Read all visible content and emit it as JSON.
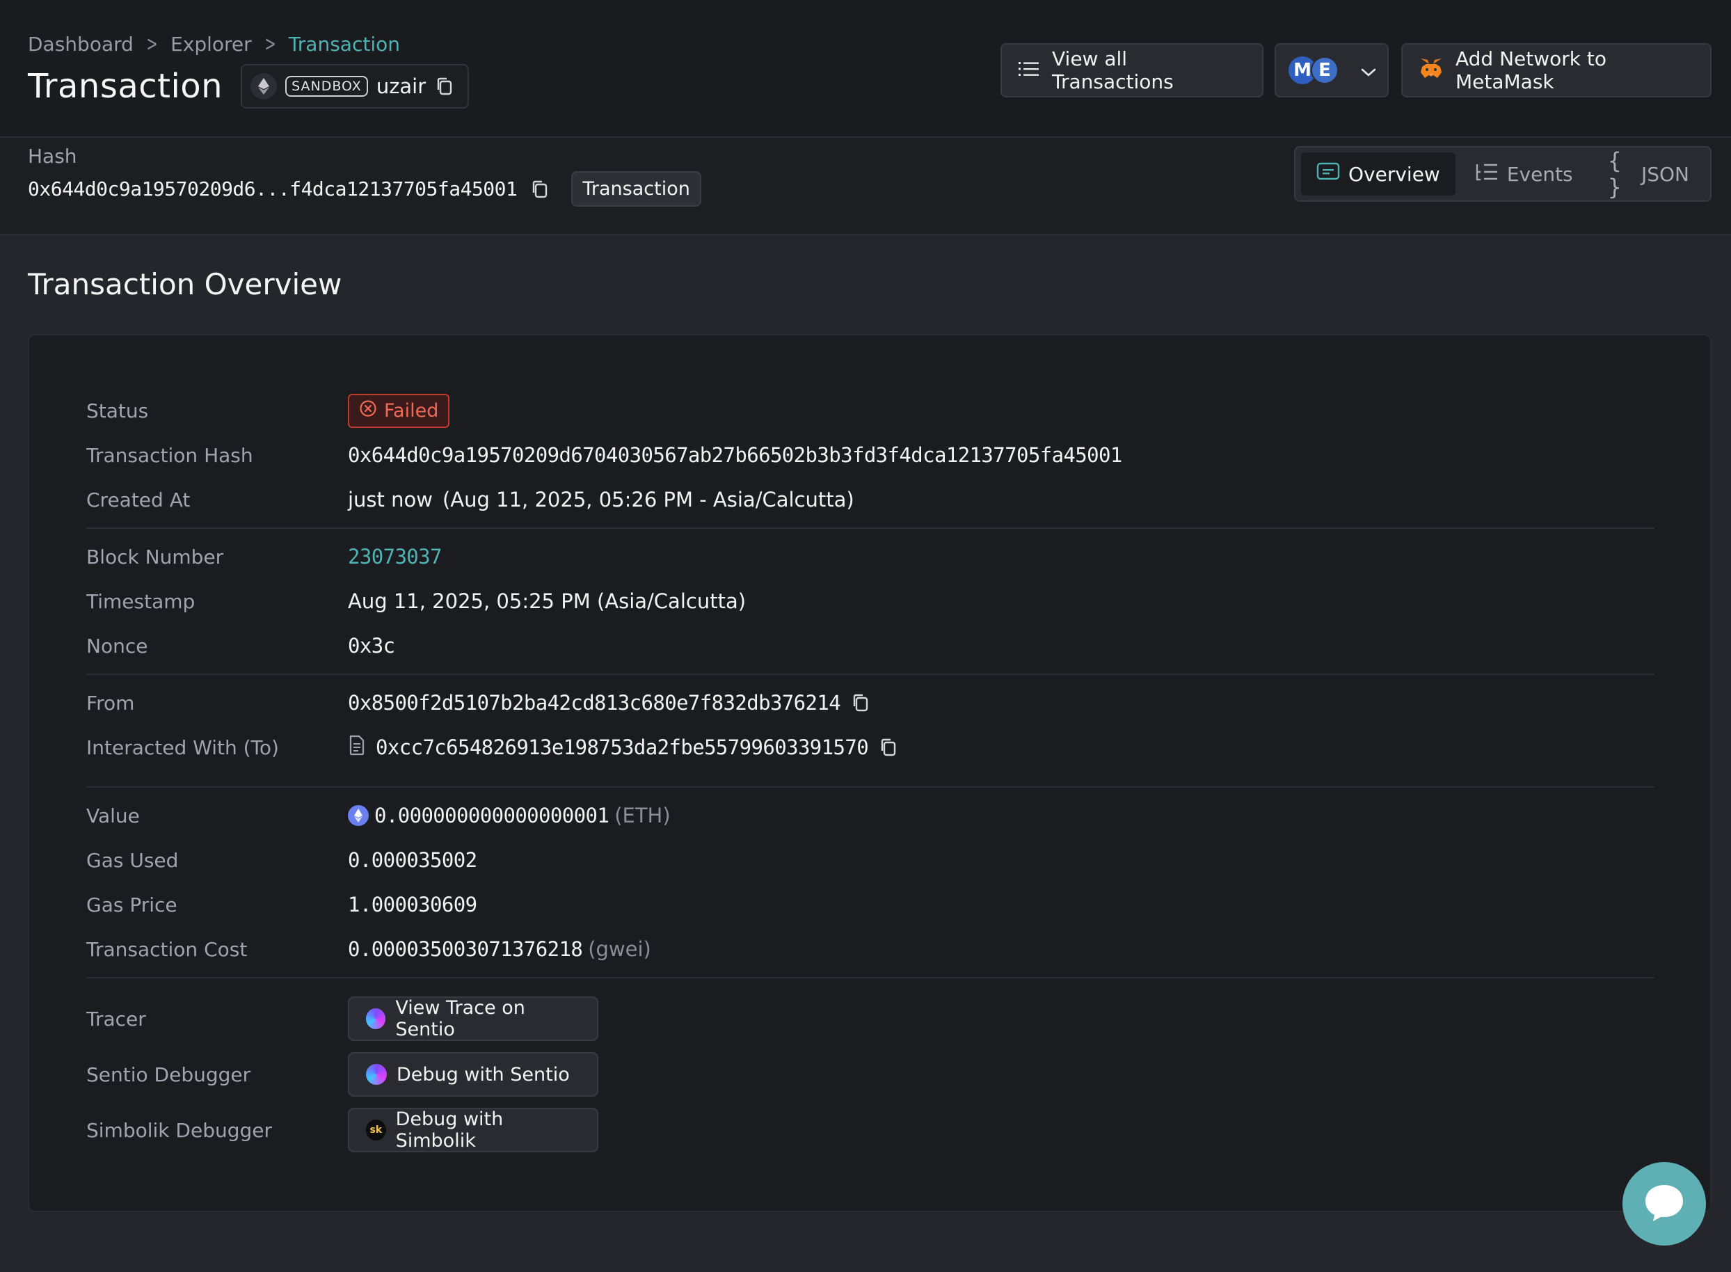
{
  "breadcrumb": {
    "items": [
      "Dashboard",
      "Explorer",
      "Transaction"
    ]
  },
  "header": {
    "title": "Transaction",
    "project": {
      "tag": "SANDBOX",
      "name": "uzair"
    },
    "buttons": {
      "view_all": "View all Transactions",
      "network_badges": [
        "M",
        "E"
      ],
      "metamask": "Add Network to MetaMask"
    }
  },
  "hashbar": {
    "label": "Hash",
    "hash_short": "0x644d0c9a19570209d6...f4dca12137705fa45001",
    "type_chip": "Transaction",
    "tabs": [
      {
        "label": "Overview",
        "icon": "overview-icon",
        "active": true
      },
      {
        "label": "Events",
        "icon": "events-icon",
        "active": false
      },
      {
        "label": "JSON",
        "icon": "braces-icon",
        "active": false
      }
    ]
  },
  "overview": {
    "section_title": "Transaction Overview",
    "status": {
      "label": "Status",
      "value": "Failed",
      "color": "#f06a55"
    },
    "tx_hash": {
      "label": "Transaction Hash",
      "value": "0x644d0c9a19570209d6704030567ab27b66502b3b3fd3f4dca12137705fa45001"
    },
    "created_at": {
      "label": "Created At",
      "relative": "just now",
      "absolute": "(Aug 11, 2025, 05:26 PM - Asia/Calcutta)"
    },
    "block_number": {
      "label": "Block Number",
      "value": "23073037"
    },
    "timestamp": {
      "label": "Timestamp",
      "value": "Aug 11, 2025, 05:25 PM (Asia/Calcutta)"
    },
    "nonce": {
      "label": "Nonce",
      "value": "0x3c"
    },
    "from": {
      "label": "From",
      "value": "0x8500f2d5107b2ba42cd813c680e7f832db376214"
    },
    "to": {
      "label": "Interacted With (To)",
      "value": "0xcc7c654826913e198753da2fbe55799603391570"
    },
    "value": {
      "label": "Value",
      "amount": "0.000000000000000001",
      "unit": "(ETH)"
    },
    "gas_used": {
      "label": "Gas Used",
      "value": "0.000035002"
    },
    "gas_price": {
      "label": "Gas Price",
      "value": "1.000030609"
    },
    "tx_cost": {
      "label": "Transaction Cost",
      "amount": "0.000035003071376218",
      "unit": "(gwei)"
    },
    "tracer": {
      "label": "Tracer",
      "button": "View Trace on Sentio"
    },
    "sentio": {
      "label": "Sentio Debugger",
      "button": "Debug with Sentio"
    },
    "simbolik": {
      "label": "Simbolik Debugger",
      "button": "Debug with Simbolik",
      "logo_text": "sk"
    }
  },
  "colors": {
    "accent": "#4fb3b3",
    "background": "#25262b",
    "header_bg": "#1a1b1f",
    "card_bg": "#1b1c20",
    "failed": "#f06a55"
  }
}
